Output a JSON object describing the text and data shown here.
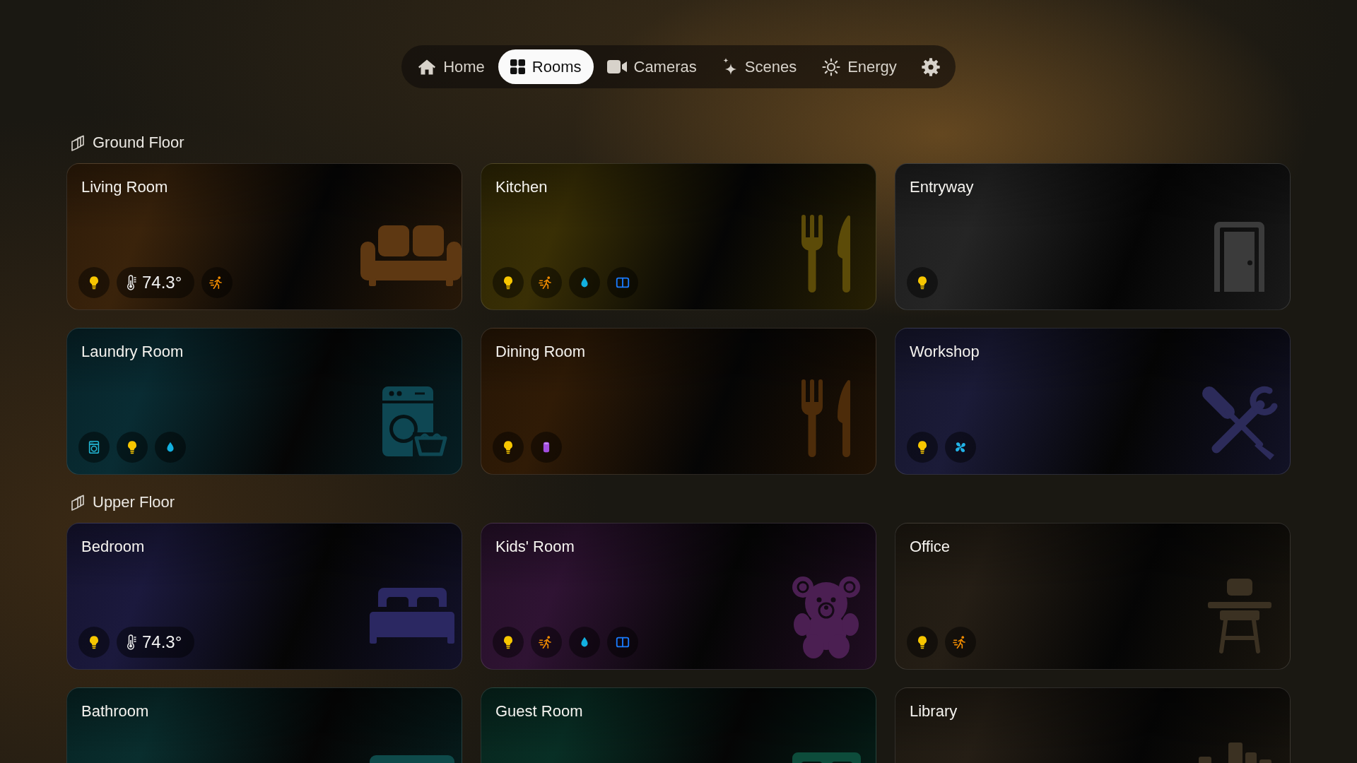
{
  "nav": {
    "tabs": [
      {
        "kind": "home",
        "label": "Home",
        "selected": false
      },
      {
        "kind": "rooms",
        "label": "Rooms",
        "selected": true
      },
      {
        "kind": "cameras",
        "label": "Cameras",
        "selected": false
      },
      {
        "kind": "scenes",
        "label": "Scenes",
        "selected": false
      },
      {
        "kind": "energy",
        "label": "Energy",
        "selected": false
      }
    ]
  },
  "floors": [
    {
      "title": "Ground Floor",
      "rooms": [
        {
          "name": "Living Room",
          "kind": "sofa",
          "color": "#5e3812",
          "chips": [
            {
              "kind": "light"
            },
            {
              "kind": "temperature",
              "value": "74.3°"
            },
            {
              "kind": "motion"
            }
          ]
        },
        {
          "name": "Kitchen",
          "kind": "cutlery",
          "color": "#5c4b08",
          "chips": [
            {
              "kind": "light"
            },
            {
              "kind": "motion"
            },
            {
              "kind": "humidity"
            },
            {
              "kind": "window"
            }
          ]
        },
        {
          "name": "Entryway",
          "kind": "door",
          "color": "#3b3b3b",
          "chips": [
            {
              "kind": "light"
            }
          ]
        },
        {
          "name": "Laundry Room",
          "kind": "washer",
          "color": "#0e4753",
          "chips": [
            {
              "kind": "washer"
            },
            {
              "kind": "light"
            },
            {
              "kind": "humidity"
            }
          ]
        },
        {
          "name": "Dining Room",
          "kind": "cutlery",
          "color": "#4d2c0a",
          "chips": [
            {
              "kind": "light"
            },
            {
              "kind": "cylinder"
            }
          ]
        },
        {
          "name": "Workshop",
          "kind": "tools",
          "color": "#2c2b5a",
          "chips": [
            {
              "kind": "light"
            },
            {
              "kind": "fan"
            }
          ]
        }
      ]
    },
    {
      "title": "Upper Floor",
      "rooms": [
        {
          "name": "Bedroom",
          "kind": "bed",
          "color": "#2b2862",
          "chips": [
            {
              "kind": "light"
            },
            {
              "kind": "temperature",
              "value": "74.3°"
            }
          ]
        },
        {
          "name": "Kids' Room",
          "kind": "teddy",
          "color": "#4b1f52",
          "chips": [
            {
              "kind": "light"
            },
            {
              "kind": "motion"
            },
            {
              "kind": "humidity"
            },
            {
              "kind": "window"
            }
          ]
        },
        {
          "name": "Office",
          "kind": "desk",
          "color": "#3b3122",
          "chips": [
            {
              "kind": "light"
            },
            {
              "kind": "motion"
            }
          ]
        },
        {
          "name": "Bathroom",
          "kind": "bathtub",
          "color": "#0e4a4a"
        },
        {
          "name": "Guest Room",
          "kind": "bed",
          "color": "#0d4c3b"
        },
        {
          "name": "Library",
          "kind": "books",
          "color": "#3b3122"
        }
      ]
    }
  ]
}
